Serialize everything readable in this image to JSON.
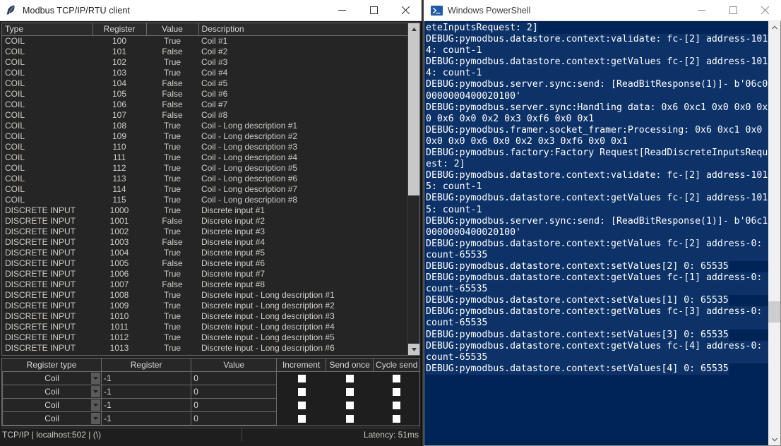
{
  "modbus_window": {
    "title": "Modbus TCP/IP/RTU client",
    "icon": "feather-icon",
    "window_controls": {
      "minimize": "minimize-icon",
      "maximize": "maximize-icon",
      "close": "close-icon"
    },
    "table": {
      "headers": [
        "Type",
        "Register",
        "Value",
        "Description"
      ],
      "rows": [
        [
          "COIL",
          "100",
          "True",
          "Coil #1"
        ],
        [
          "COIL",
          "101",
          "False",
          "Coil #2"
        ],
        [
          "COIL",
          "102",
          "True",
          "Coil #3"
        ],
        [
          "COIL",
          "103",
          "True",
          "Coil #4"
        ],
        [
          "COIL",
          "104",
          "False",
          "Coil #5"
        ],
        [
          "COIL",
          "105",
          "False",
          "Coil #6"
        ],
        [
          "COIL",
          "106",
          "False",
          "Coil #7"
        ],
        [
          "COIL",
          "107",
          "False",
          "Coil #8"
        ],
        [
          "COIL",
          "108",
          "True",
          "Coil - Long description #1"
        ],
        [
          "COIL",
          "109",
          "True",
          "Coil - Long description #2"
        ],
        [
          "COIL",
          "110",
          "True",
          "Coil - Long description #3"
        ],
        [
          "COIL",
          "111",
          "True",
          "Coil - Long description #4"
        ],
        [
          "COIL",
          "112",
          "True",
          "Coil - Long description #5"
        ],
        [
          "COIL",
          "113",
          "True",
          "Coil - Long description #6"
        ],
        [
          "COIL",
          "114",
          "True",
          "Coil - Long description #7"
        ],
        [
          "COIL",
          "115",
          "True",
          "Coil - Long description #8"
        ],
        [
          "DISCRETE INPUT",
          "1000",
          "True",
          "Discrete input #1"
        ],
        [
          "DISCRETE INPUT",
          "1001",
          "False",
          "Discrete input #2"
        ],
        [
          "DISCRETE INPUT",
          "1002",
          "True",
          "Discrete input #3"
        ],
        [
          "DISCRETE INPUT",
          "1003",
          "False",
          "Discrete input #4"
        ],
        [
          "DISCRETE INPUT",
          "1004",
          "True",
          "Discrete input #5"
        ],
        [
          "DISCRETE INPUT",
          "1005",
          "False",
          "Discrete input #6"
        ],
        [
          "DISCRETE INPUT",
          "1006",
          "True",
          "Discrete input #7"
        ],
        [
          "DISCRETE INPUT",
          "1007",
          "False",
          "Discrete input #8"
        ],
        [
          "DISCRETE INPUT",
          "1008",
          "True",
          "Discrete input - Long description #1"
        ],
        [
          "DISCRETE INPUT",
          "1009",
          "True",
          "Discrete input - Long description #2"
        ],
        [
          "DISCRETE INPUT",
          "1010",
          "True",
          "Discrete input - Long description #3"
        ],
        [
          "DISCRETE INPUT",
          "1011",
          "True",
          "Discrete input - Long description #4"
        ],
        [
          "DISCRETE INPUT",
          "1012",
          "True",
          "Discrete input - Long description #5"
        ],
        [
          "DISCRETE INPUT",
          "1013",
          "True",
          "Discrete input - Long description #6"
        ]
      ]
    },
    "command_panel": {
      "headers": {
        "register_type": "Register type",
        "register": "Register",
        "value": "Value",
        "increment": "Increment",
        "send_once": "Send once",
        "cycle_send": "Cycle send"
      },
      "rows": [
        {
          "register_type": "Coil",
          "register": "-1",
          "value": "0",
          "increment": false,
          "send_once": false,
          "cycle_send": false
        },
        {
          "register_type": "Coil",
          "register": "-1",
          "value": "0",
          "increment": false,
          "send_once": false,
          "cycle_send": false
        },
        {
          "register_type": "Coil",
          "register": "-1",
          "value": "0",
          "increment": false,
          "send_once": false,
          "cycle_send": false
        },
        {
          "register_type": "Coil",
          "register": "-1",
          "value": "0",
          "increment": false,
          "send_once": false,
          "cycle_send": false
        }
      ]
    },
    "status_bar": {
      "connection": "TCP/IP | localhost:502 | (\\)",
      "latency": "Latency: 51ms"
    }
  },
  "powershell_window": {
    "title": "Windows PowerShell",
    "icon": "powershell-icon",
    "window_controls": {
      "minimize": "minimize-icon",
      "maximize": "maximize-icon",
      "close": "close-icon"
    },
    "console_lines": [
      "eteInputsRequest: 2]",
      "DEBUG:pymodbus.datastore.context:validate: fc-[2] address-1014: count-1",
      "DEBUG:pymodbus.datastore.context:getValues fc-[2] address-1014: count-1",
      "DEBUG:pymodbus.server.sync:send: [ReadBitResponse(1)]- b'06c00000000400020100'",
      "DEBUG:pymodbus.server.sync:Handling data: 0x6 0xc1 0x0 0x0 0x0 0x6 0x0 0x2 0x3 0xf6 0x0 0x1",
      "DEBUG:pymodbus.framer.socket_framer:Processing: 0x6 0xc1 0x0 0x0 0x0 0x6 0x0 0x2 0x3 0xf6 0x0 0x1",
      "DEBUG:pymodbus.factory:Factory Request[ReadDiscreteInputsRequest: 2]",
      "DEBUG:pymodbus.datastore.context:validate: fc-[2] address-1015: count-1",
      "DEBUG:pymodbus.datastore.context:getValues fc-[2] address-1015: count-1",
      "DEBUG:pymodbus.server.sync:send: [ReadBitResponse(1)]- b'06c10000000400020100'",
      "DEBUG:pymodbus.datastore.context:getValues fc-[2] address-0: count-65535",
      "DEBUG:pymodbus.datastore.context:setValues[2] 0: 65535",
      "DEBUG:pymodbus.datastore.context:getValues fc-[1] address-0: count-65535",
      "DEBUG:pymodbus.datastore.context:setValues[1] 0: 65535",
      "DEBUG:pymodbus.datastore.context:getValues fc-[3] address-0: count-65535",
      "DEBUG:pymodbus.datastore.context:setValues[3] 0: 65535",
      "DEBUG:pymodbus.datastore.context:getValues fc-[4] address-0: count-65535",
      "DEBUG:pymodbus.datastore.context:setValues[4] 0: 65535"
    ]
  },
  "colors": {
    "powershell_bg": "#012456",
    "powershell_selection": "#0d3268",
    "modbus_bg": "#1e1e1e",
    "titlebar_bg": "#ffffff",
    "table_text": "#d0cdc7"
  }
}
